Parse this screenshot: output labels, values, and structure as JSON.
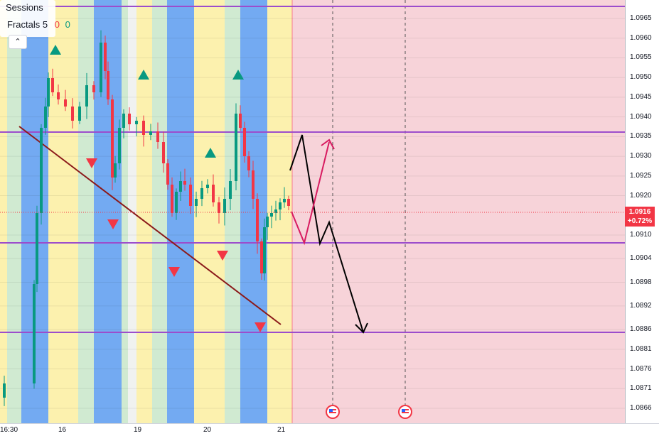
{
  "legend": {
    "indicator_1": "Sessions",
    "indicator_2": "Fractals",
    "indicator_2_param": "5",
    "indicator_2_value_up": "0",
    "indicator_2_value_down": "0",
    "collapse_icon": "chevron-up-icon"
  },
  "price_axis": {
    "ticks": [
      "1.0965",
      "1.0960",
      "1.0955",
      "1.0950",
      "1.0945",
      "1.0940",
      "1.0935",
      "1.0930",
      "1.0925",
      "1.0920",
      "1.0910",
      "1.0904",
      "1.0898",
      "1.0892",
      "1.0886",
      "1.0881",
      "1.0876",
      "1.0871",
      "1.0866"
    ],
    "current_price": "1.0916",
    "current_change": "+0.72%"
  },
  "time_axis": {
    "ticks": [
      "16:30",
      "16",
      "19",
      "20",
      "21"
    ]
  },
  "events": [
    {
      "icon": "us-flag-icon"
    },
    {
      "icon": "us-flag-icon"
    }
  ],
  "colors": {
    "session_green": "#c8e6c9",
    "session_blue": "#5b9bf0",
    "session_yellow": "#fbeea0",
    "forecast_zone": "#f7d3d9",
    "horizontal_line": "#9c4dcc",
    "trendline": "#8b1a1a",
    "candle_up": "#089981",
    "candle_down": "#f23645",
    "fractal_up": "#089981",
    "fractal_down": "#f23645",
    "projection_black": "#000000",
    "projection_red": "#d81b60"
  }
}
